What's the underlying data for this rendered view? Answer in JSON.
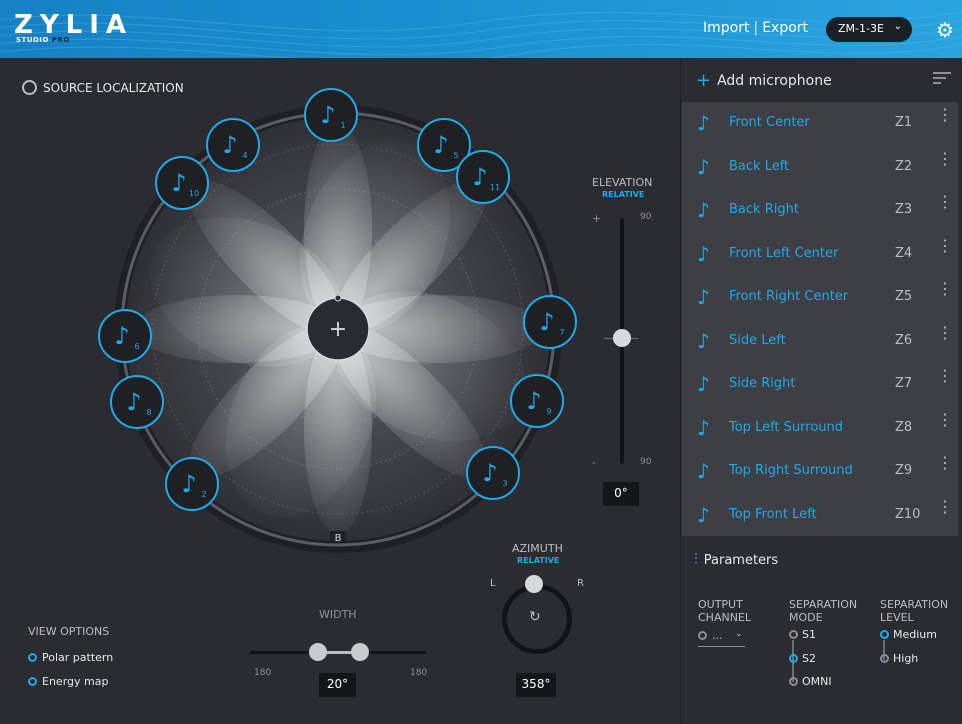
{
  "header": {
    "logo": "ZYLIA",
    "logo_sub_studio": "STUDIO",
    "logo_sub_pro": "PRO",
    "import_label": "Import",
    "export_label": "Export",
    "device": "ZM-1-3E",
    "accent_color": "#21a9e8"
  },
  "source_localization": {
    "title": "SOURCE LOCALIZATION",
    "center_icon": "plus-icon",
    "bottom_marker": "B",
    "sources": [
      {
        "number": "1"
      },
      {
        "number": "4"
      },
      {
        "number": "5"
      },
      {
        "number": "11"
      },
      {
        "number": "10"
      },
      {
        "number": "6"
      },
      {
        "number": "8"
      },
      {
        "number": "7"
      },
      {
        "number": "9"
      },
      {
        "number": "2"
      },
      {
        "number": "3"
      }
    ]
  },
  "elevation": {
    "label": "ELEVATION",
    "mode": "RELATIVE",
    "plus": "+",
    "minus": "-",
    "max": "90",
    "min": "90",
    "value": "0°",
    "position_fraction": 0.5
  },
  "view_options": {
    "title": "VIEW OPTIONS",
    "options": [
      "Polar pattern",
      "Energy map"
    ]
  },
  "width": {
    "label": "WIDTH",
    "min": "180",
    "max": "180",
    "value": "20°"
  },
  "azimuth": {
    "label": "AZIMUTH",
    "mode": "RELATIVE",
    "left": "L",
    "right": "R",
    "value": "358°"
  },
  "microphones": {
    "add_label": "Add microphone",
    "items": [
      {
        "name": "Front Center",
        "zone": "Z1"
      },
      {
        "name": "Back Left",
        "zone": "Z2"
      },
      {
        "name": "Back Right",
        "zone": "Z3"
      },
      {
        "name": "Front Left Center",
        "zone": "Z4"
      },
      {
        "name": "Front Right Center",
        "zone": "Z5"
      },
      {
        "name": "Side Left",
        "zone": "Z6"
      },
      {
        "name": "Side Right",
        "zone": "Z7"
      },
      {
        "name": "Top Left Surround",
        "zone": "Z8"
      },
      {
        "name": "Top Right Surround",
        "zone": "Z9"
      },
      {
        "name": "Top Front Left",
        "zone": "Z10"
      }
    ]
  },
  "parameters": {
    "title": "Parameters",
    "output_channel": {
      "label_1": "OUTPUT",
      "label_2": "CHANNEL",
      "value": "..."
    },
    "separation_mode": {
      "label_1": "SEPARATION",
      "label_2": "MODE",
      "options": [
        "S1",
        "S2",
        "OMNI"
      ],
      "selected": "S2"
    },
    "separation_level": {
      "label_1": "SEPARATION",
      "label_2": "LEVEL",
      "options": [
        "Medium",
        "High"
      ],
      "selected": "Medium"
    }
  }
}
